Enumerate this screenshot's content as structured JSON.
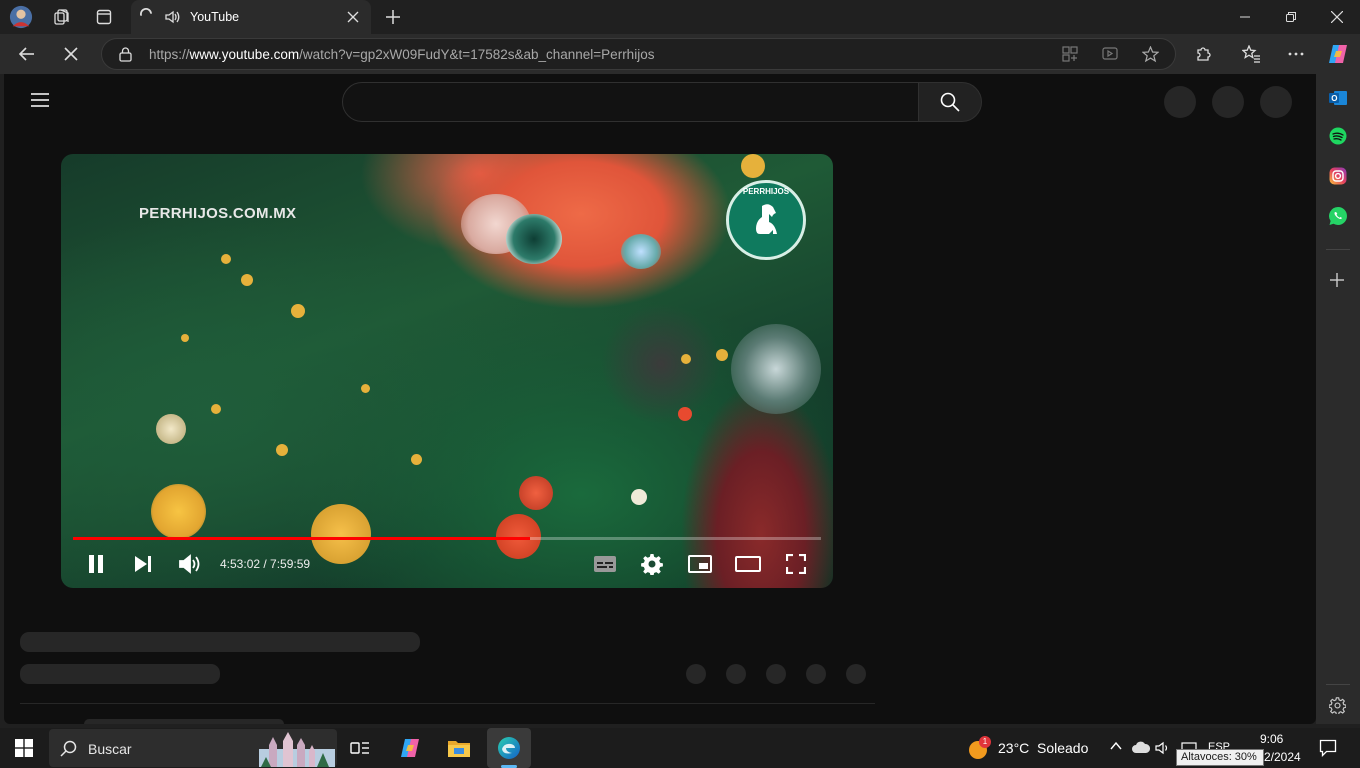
{
  "tab": {
    "title": "YouTube"
  },
  "address_bar": {
    "url_prefix": "https://",
    "url_host": "www.youtube.com",
    "url_rest": "/watch?v=gp2xW09FudY&t=17582s&ab_channel=Perrhijos"
  },
  "video": {
    "watermark": "PERRHIJOS.COM.MX",
    "logo_text": "PERRHIJOS",
    "time_display": "4:53:02 / 7:59:59",
    "progress_fraction": 0.6104,
    "buffer_fraction": 0.6104
  },
  "taskbar": {
    "search_label": "Buscar",
    "weather_temp": "23°C",
    "weather_condition": "Soleado",
    "weather_badge": "1",
    "language": "ESP",
    "time": "9:06",
    "date": "2/2024",
    "volume_tooltip": "Altavoces: 30%"
  },
  "colors": {
    "youtube_red": "#ff0000",
    "edge_bg": "#202020",
    "page_bg": "#0f0f0f"
  }
}
